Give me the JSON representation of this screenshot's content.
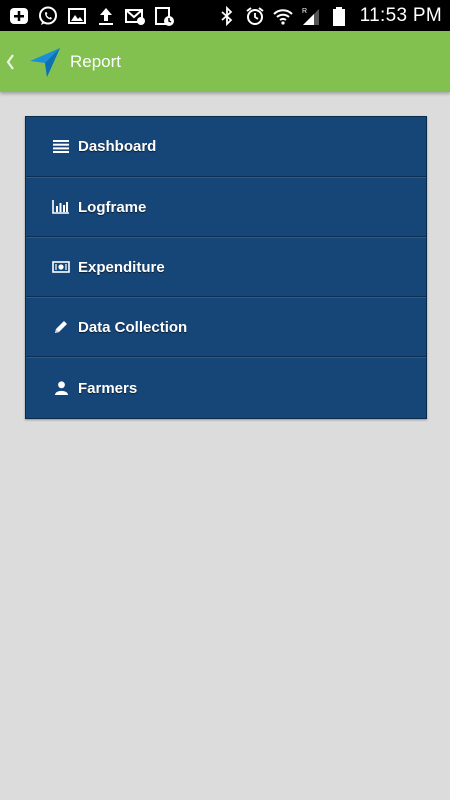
{
  "status_bar": {
    "time": "11:53 PM",
    "left_icons": [
      "add-box-icon",
      "whatsapp-icon",
      "image-icon",
      "upload-icon",
      "mail-notification-icon",
      "calendar-clock-icon"
    ],
    "right_icons": [
      "bluetooth-icon",
      "alarm-icon",
      "wifi-icon",
      "signal-icon",
      "battery-icon"
    ]
  },
  "action_bar": {
    "title": "Report",
    "back_icon": "chevron-left-icon",
    "app_icon": "navigation-arrow-icon",
    "color": "#82c14f"
  },
  "menu": {
    "color": "#164678",
    "items": [
      {
        "label": "Dashboard",
        "icon": "list-icon"
      },
      {
        "label": "Logframe",
        "icon": "bar-chart-icon"
      },
      {
        "label": "Expenditure",
        "icon": "money-icon"
      },
      {
        "label": "Data Collection",
        "icon": "pencil-icon"
      },
      {
        "label": "Farmers",
        "icon": "user-icon"
      }
    ]
  }
}
